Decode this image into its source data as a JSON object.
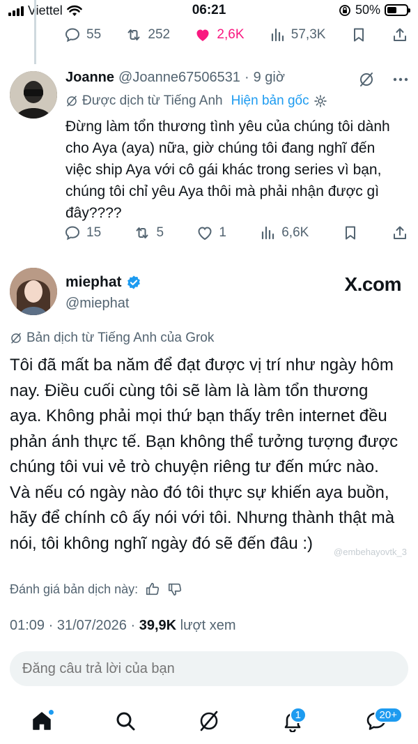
{
  "status_bar": {
    "carrier": "Viettel",
    "time": "06:21",
    "battery": "50%",
    "battery_level": 0.5
  },
  "prev_tweet_actions": {
    "replies": "55",
    "retweets": "252",
    "likes": "2,6K",
    "views": "57,3K"
  },
  "reply": {
    "name": "Joanne",
    "handle": "@Joanne67506531",
    "separator": "·",
    "time": "9 giờ",
    "translated_label": "Được dịch từ Tiếng Anh",
    "show_original": "Hiện bản gốc",
    "text": "Đừng làm tổn thương tình yêu của chúng tôi dành cho Aya (aya) nữa, giờ chúng tôi đang nghĩ đến việc ship Aya với cô gái khác trong series vì bạn, chúng tôi chỉ yêu Aya thôi mà phải nhận được gì đây????",
    "actions": {
      "replies": "15",
      "retweets": "5",
      "likes": "1",
      "views": "6,6K"
    }
  },
  "main_tweet": {
    "name": "miephat",
    "handle": "@miephat",
    "brand": "X.com",
    "translation_label": "Bản dịch từ Tiếng Anh của Grok",
    "text": "Tôi đã mất ba năm để đạt được vị trí như ngày hôm nay. Điều cuối cùng tôi sẽ làm là làm tổn thương aya. Không phải mọi thứ bạn thấy trên internet đều phản ánh thực tế. Bạn không thể tưởng tượng được chúng tôi vui vẻ trò chuyện riêng tư đến mức nào. Và nếu có ngày nào đó tôi thực sự khiến aya buồn, hãy để chính cô ấy nói với tôi. Nhưng thành thật mà nói, tôi không nghĩ ngày đó sẽ đến đâu :)",
    "watermark": "@embehayovtk_3",
    "rate_label": "Đánh giá bản dịch này:",
    "timestamp": "01:09 · 31/07/2026 ·",
    "views": "39,9K",
    "views_label": "lượt xem"
  },
  "reply_input": {
    "placeholder": "Đăng câu trả lời của bạn"
  },
  "bottom_nav": {
    "notifications_badge": "1",
    "messages_badge": "20+"
  },
  "colors": {
    "accent": "#1d9bf0",
    "like": "#f91880",
    "muted": "#536471",
    "text": "#0f1419"
  }
}
